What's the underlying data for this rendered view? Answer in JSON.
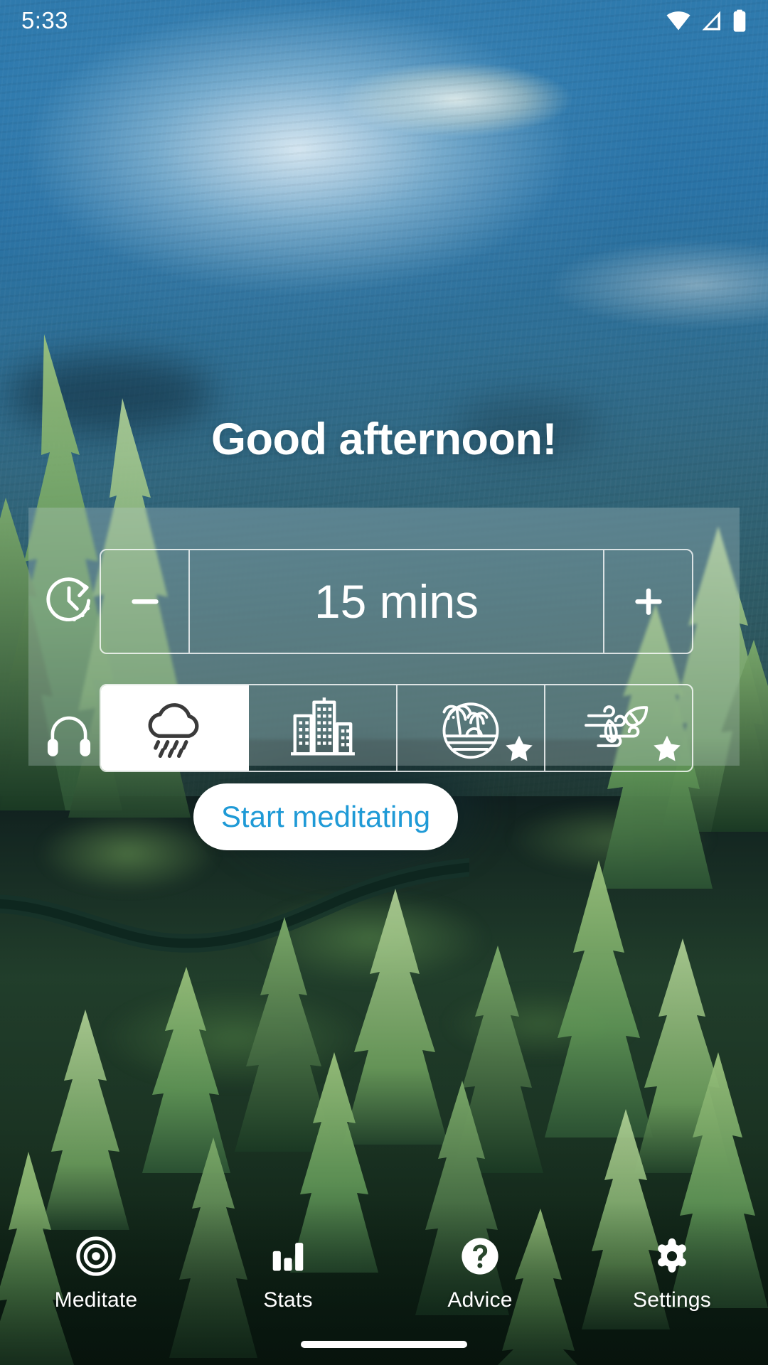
{
  "status_bar": {
    "time": "5:33",
    "icons": [
      "wifi-icon",
      "cellular-signal-icon",
      "battery-icon"
    ]
  },
  "greeting": {
    "text": "Good afternoon!"
  },
  "session_card": {
    "duration_row": {
      "leading_icon": "clock-timer-icon",
      "decrease_label": "–",
      "decrease_icon": "minus-icon",
      "value": "15 mins",
      "increase_label": "+",
      "increase_icon": "plus-icon"
    },
    "sound_row": {
      "leading_icon": "headphones-icon",
      "options": [
        {
          "name": "rain",
          "icon": "rain-cloud-icon",
          "selected": true,
          "premium": false
        },
        {
          "name": "city",
          "icon": "city-buildings-icon",
          "selected": false,
          "premium": false
        },
        {
          "name": "beach",
          "icon": "beach-palm-island-icon",
          "selected": false,
          "premium": true
        },
        {
          "name": "wind",
          "icon": "wind-leaves-icon",
          "selected": false,
          "premium": true
        }
      ],
      "premium_badge_icon": "star-icon"
    },
    "primary_action": {
      "label": "Start meditating",
      "text_color": "#1f9ad6",
      "background_color": "#ffffff"
    }
  },
  "bottom_nav": {
    "items": [
      {
        "label": "Meditate",
        "icon": "target-circles-icon",
        "active": true
      },
      {
        "label": "Stats",
        "icon": "bar-chart-icon",
        "active": false
      },
      {
        "label": "Advice",
        "icon": "question-mark-circle-icon",
        "active": false
      },
      {
        "label": "Settings",
        "icon": "gear-icon",
        "active": false
      }
    ]
  },
  "system": {
    "home_indicator": "home-indicator"
  }
}
